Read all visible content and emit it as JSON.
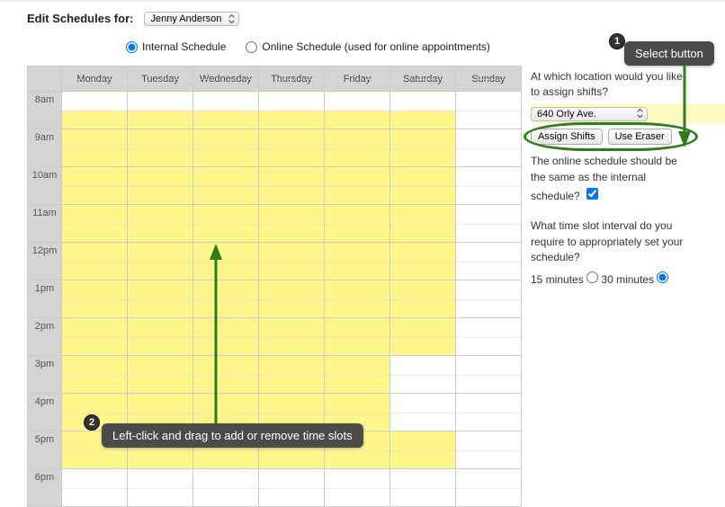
{
  "header": {
    "title": "Edit Schedules for:"
  },
  "employee_select": {
    "value": "Jenny Anderson",
    "options": [
      "Jenny Anderson"
    ]
  },
  "schedule_type": {
    "internal_label": "Internal Schedule",
    "online_label": "Online Schedule (used for online appointments)",
    "selected": "internal"
  },
  "days": [
    "Monday",
    "Tuesday",
    "Wednesday",
    "Thursday",
    "Friday",
    "Saturday",
    "Sunday"
  ],
  "hours": [
    "8am",
    "9am",
    "10am",
    "11am",
    "12pm",
    "1pm",
    "2pm",
    "3pm",
    "4pm",
    "5pm",
    "6pm"
  ],
  "shifts_comment": "columns mon..sun, rows 8am..5pm; 1 = full-hour yellow, 0.5 = bottom-half yellow",
  "shifts": {
    "mon": {
      "8am": 0.5,
      "9am": 1,
      "10am": 1,
      "11am": 1,
      "12pm": 1,
      "1pm": 1,
      "2pm": 1,
      "3pm": 1,
      "4pm": 1,
      "5pm": 1
    },
    "tue": {
      "8am": 0.5,
      "9am": 1,
      "10am": 1,
      "11am": 1,
      "12pm": 1,
      "1pm": 1,
      "2pm": 1,
      "3pm": 1,
      "4pm": 1,
      "5pm": 1
    },
    "wed": {
      "8am": 0.5,
      "9am": 1,
      "10am": 1,
      "11am": 1,
      "12pm": 1,
      "1pm": 1,
      "2pm": 1,
      "3pm": 1,
      "4pm": 1,
      "5pm": 1
    },
    "thu": {
      "8am": 0.5,
      "9am": 1,
      "10am": 1,
      "11am": 1,
      "12pm": 1,
      "1pm": 1,
      "2pm": 1,
      "3pm": 1,
      "4pm": 1,
      "5pm": 1
    },
    "fri": {
      "8am": 0.5,
      "9am": 1,
      "10am": 1,
      "11am": 1,
      "12pm": 1,
      "1pm": 1,
      "2pm": 1,
      "3pm": 1,
      "4pm": 1,
      "5pm": 1
    },
    "sat": {
      "8am": 0.5,
      "9am": 1,
      "10am": 1,
      "11am": 1,
      "12pm": 1,
      "1pm": 1,
      "2pm": 1,
      "5pm": 1
    },
    "sun": {}
  },
  "side": {
    "loc_question": "At which location would you like to assign shifts?",
    "loc_value": "640 Orly Ave.",
    "assign_label": "Assign Shifts",
    "eraser_label": "Use Eraser",
    "same_question": "The online schedule should be the same as the internal schedule?",
    "same_checked": true,
    "interval_q": "What time slot interval do you require to appropriately set your schedule?",
    "int15_label": "15 minutes",
    "int30_label": "30 minutes",
    "interval_selected": "30"
  },
  "annotations": {
    "a1": {
      "n": "1",
      "text": "Select button"
    },
    "a2": {
      "n": "2",
      "text": "Left-click and drag to add or remove time slots"
    }
  }
}
